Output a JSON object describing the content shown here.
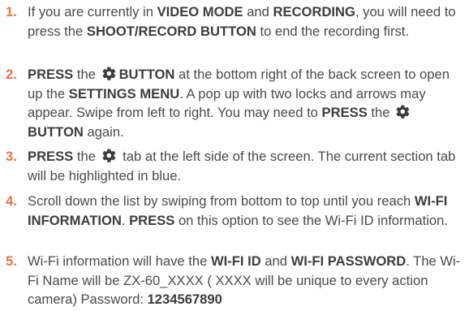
{
  "steps": [
    {
      "number": "1.",
      "parts": [
        "If you are currently in ",
        "VIDEO MODE",
        " and ",
        "RECORDING",
        ", you will need to press the ",
        "SHOOT/RECORD BUTTON",
        " to end the recording first."
      ]
    },
    {
      "number": "2.",
      "parts": [
        "PRESS",
        " the ",
        "BUTTON",
        " at the bottom right of the back screen to open up the ",
        "SETTINGS MENU",
        ". A pop up with two locks and arrows may appear. Swipe from left to right. You may need to ",
        "PRESS",
        " the ",
        "BUTTON",
        " again."
      ]
    },
    {
      "number": "3.",
      "parts": [
        "PRESS",
        " the ",
        " tab at the left side of the screen. The current section tab will be highlighted in blue."
      ]
    },
    {
      "number": "4.",
      "parts": [
        "Scroll down the list by swiping from bottom to top until you reach ",
        "WI-FI INFORMATION",
        ". ",
        "PRESS",
        " on this option to see the Wi-Fi ID information."
      ]
    },
    {
      "number": "5.",
      "parts": [
        "Wi-Fi information will have the ",
        "WI-FI ID",
        " and ",
        "WI-FI PASSWORD",
        ". The Wi-Fi Name will be ZX-60_XXXX ( XXXX will be unique to every action camera) Password: ",
        "1234567890"
      ]
    }
  ],
  "icons": {
    "settings": "gear-icon"
  },
  "colors": {
    "number": "#e8734a",
    "text": "#4a4a4a",
    "bold": "#3d3d3d",
    "icon": "#3d3d3d"
  }
}
